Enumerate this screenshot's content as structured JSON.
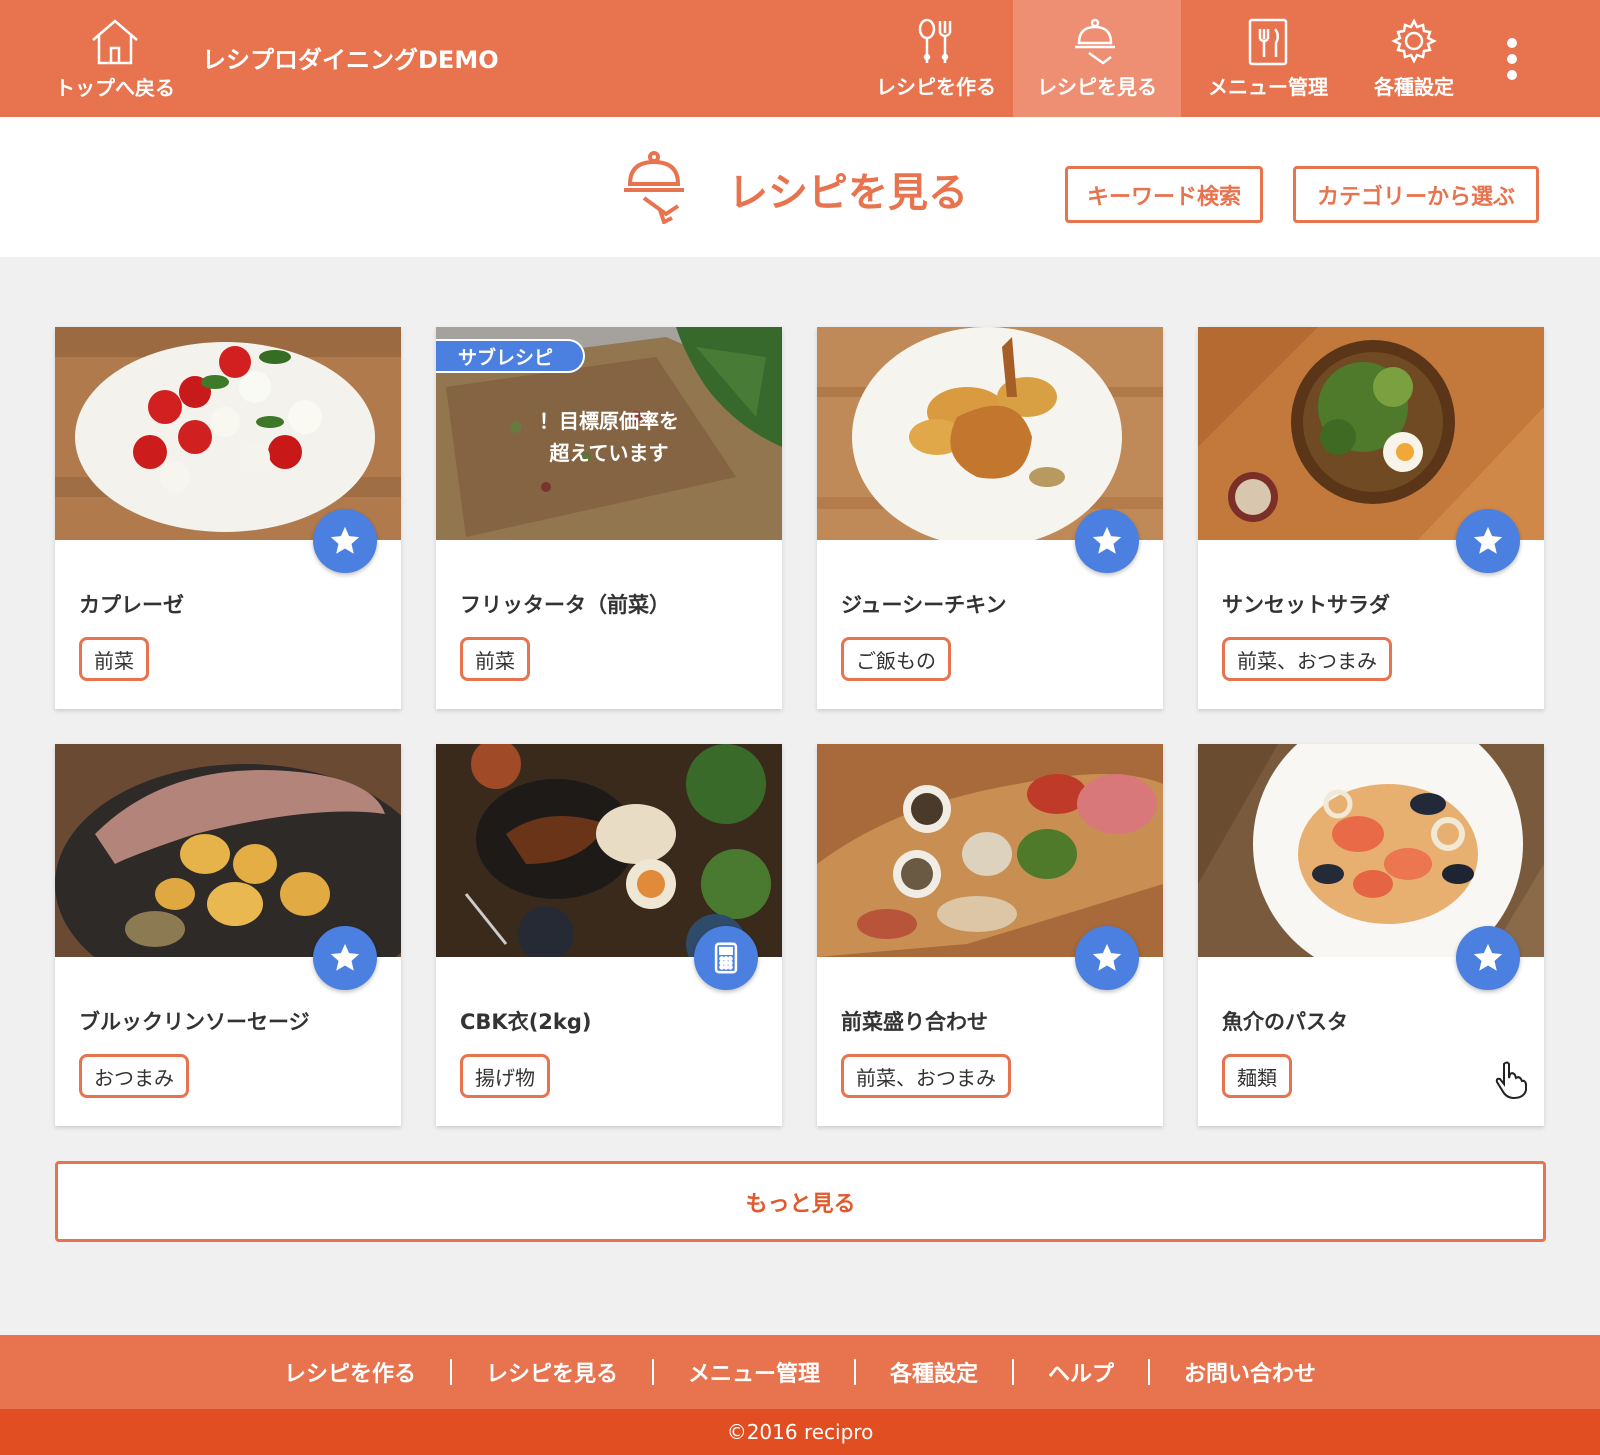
{
  "header": {
    "home_label": "トップへ戻る",
    "brand": "レシプロダイニングDEMO",
    "nav": [
      {
        "label": "レシピを作る",
        "icon": "utensils-pair-icon"
      },
      {
        "label": "レシピを見る",
        "icon": "cloche-serving-icon",
        "active": true
      },
      {
        "label": "メニュー管理",
        "icon": "menu-card-icon"
      },
      {
        "label": "各種設定",
        "icon": "gear-icon"
      }
    ]
  },
  "page": {
    "title": "レシピを見る",
    "keyword_search": "キーワード検索",
    "category_select": "カテゴリーから選ぶ"
  },
  "cards": [
    {
      "title": "カプレーゼ",
      "tag": "前菜",
      "action_icon": "star-icon"
    },
    {
      "title": "フリッタータ（前菜）",
      "tag": "前菜",
      "badge": "サブレシピ",
      "overlay": "！目標原価率を\n超えています"
    },
    {
      "title": "ジューシーチキン",
      "tag": "ご飯もの",
      "action_icon": "star-icon"
    },
    {
      "title": "サンセットサラダ",
      "tag": "前菜、おつまみ",
      "action_icon": "star-icon"
    },
    {
      "title": "ブルックリンソーセージ",
      "tag": "おつまみ",
      "action_icon": "star-icon"
    },
    {
      "title": "CBK衣(2kg)",
      "tag": "揚げ物",
      "action_icon": "calculator-icon"
    },
    {
      "title": "前菜盛り合わせ",
      "tag": "前菜、おつまみ",
      "action_icon": "star-icon"
    },
    {
      "title": "魚介のパスタ",
      "tag": "麺類",
      "action_icon": "star-icon"
    }
  ],
  "more_label": "もっと見る",
  "footer": {
    "links": [
      "レシピを作る",
      "レシピを見る",
      "メニュー管理",
      "各種設定",
      "ヘルプ",
      "お問い合わせ"
    ],
    "copyright": "©2016 recipro"
  },
  "colors": {
    "brand": "#e8734f",
    "brand_dark": "#e04e22",
    "accent": "#4b7fe0"
  }
}
